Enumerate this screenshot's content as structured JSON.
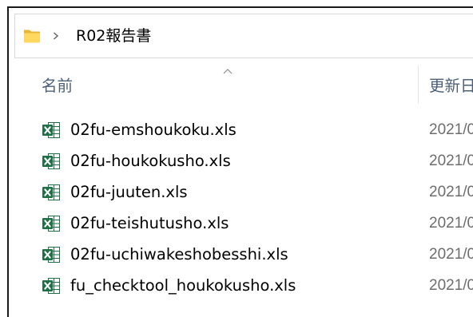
{
  "address_bar": {
    "icon": "folder-icon",
    "separator_icon": "chevron-right-icon",
    "breadcrumb": [
      "R02報告書"
    ]
  },
  "columns": {
    "name": "名前",
    "name_sort_icon": "chevron-up-icon",
    "modified": "更新日"
  },
  "files": [
    {
      "icon": "excel-file-icon",
      "name": "02fu-emshoukoku.xls",
      "modified": "2021/0"
    },
    {
      "icon": "excel-file-icon",
      "name": "02fu-houkokusho.xls",
      "modified": "2021/0"
    },
    {
      "icon": "excel-file-icon",
      "name": "02fu-juuten.xls",
      "modified": "2021/0"
    },
    {
      "icon": "excel-file-icon",
      "name": "02fu-teishutusho.xls",
      "modified": "2021/0"
    },
    {
      "icon": "excel-file-icon",
      "name": "02fu-uchiwakeshobesshi.xls",
      "modified": "2021/0"
    },
    {
      "icon": "excel-file-icon",
      "name": "fu_checktool_houkokusho.xls",
      "modified": "2021/0"
    }
  ],
  "colors": {
    "header_text": "#4c607a",
    "date_text": "#6d6d6d",
    "folder_yellow": "#ffd862",
    "excel_green": "#1e7145"
  }
}
